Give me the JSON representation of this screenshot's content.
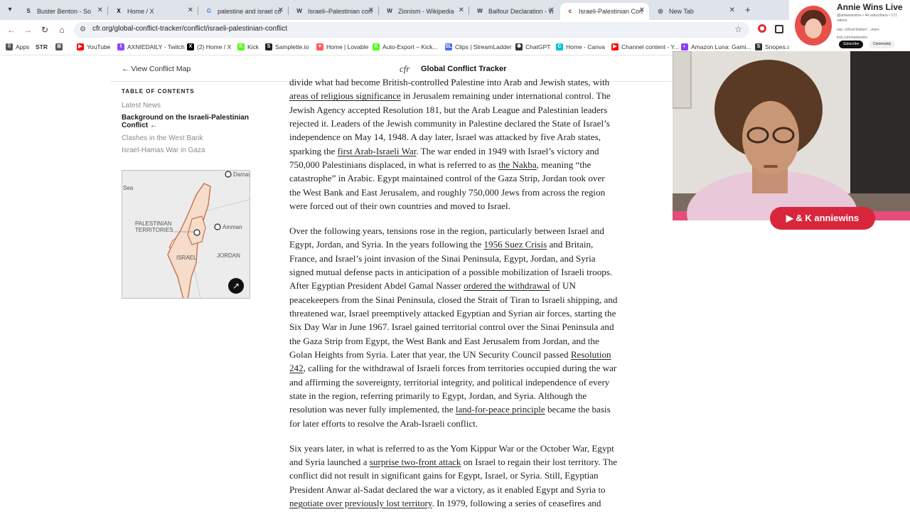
{
  "browser": {
    "tabs": [
      {
        "label": "Buster Benton - So",
        "icon": "soundcloud-icon",
        "color": "#333333",
        "glyph": "S"
      },
      {
        "label": "Home / X",
        "icon": "x-icon",
        "color": "#000000",
        "glyph": "X"
      },
      {
        "label": "palestine and israel co",
        "icon": "google-icon",
        "color": "#4285f4",
        "glyph": "G"
      },
      {
        "label": "Israeli–Palestinian conf",
        "icon": "wikipedia-icon",
        "color": "#333333",
        "glyph": "W"
      },
      {
        "label": "Zionism - Wikipedia",
        "icon": "wikipedia-icon",
        "color": "#333333",
        "glyph": "W"
      },
      {
        "label": "Balfour Declaration - W",
        "icon": "wikipedia-icon",
        "color": "#333333",
        "glyph": "W"
      },
      {
        "label": "Israeli-Palestinian Con",
        "icon": "cfr-icon",
        "color": "#8b1a1a",
        "glyph": "c"
      },
      {
        "label": "New Tab",
        "icon": "chrome-icon",
        "color": "#444444",
        "glyph": "◎"
      }
    ],
    "url": "cfr.org/global-conflict-tracker/conflict/israeli-palestinian-conflict",
    "bookmarks": [
      {
        "label": "Apps",
        "icon": "apps-grid-icon",
        "color": "#555555",
        "glyph": "⠿"
      },
      {
        "label": "STR",
        "icon": "str-icon",
        "color": "#ffffff",
        "glyph": ""
      },
      {
        "label": "",
        "icon": "grid-icon",
        "color": "#555555",
        "glyph": "⊞"
      },
      {
        "label": "YouTube",
        "icon": "youtube-icon",
        "color": "#ff0000",
        "glyph": "▶"
      },
      {
        "label": "AXNIEDAILY - Twitch",
        "icon": "twitch-icon",
        "color": "#9146ff",
        "glyph": "t"
      },
      {
        "label": "(2) Home / X",
        "icon": "x-icon",
        "color": "#000000",
        "glyph": "X"
      },
      {
        "label": "Kick",
        "icon": "kick-icon",
        "color": "#53fc18",
        "glyph": "K"
      },
      {
        "label": "Samplette.io",
        "icon": "samplette-icon",
        "color": "#222222",
        "glyph": "S"
      },
      {
        "label": "Home | Lovable",
        "icon": "lovable-icon",
        "color": "#ff5a5f",
        "glyph": "♥"
      },
      {
        "label": "Auto-Export – Kick...",
        "icon": "kick-icon",
        "color": "#53fc18",
        "glyph": "K"
      },
      {
        "label": "Clips | StreamLadder",
        "icon": "streamladder-icon",
        "color": "#4f6bed",
        "glyph": "SL"
      },
      {
        "label": "ChatGPT",
        "icon": "chatgpt-icon",
        "color": "#333333",
        "glyph": "✺"
      },
      {
        "label": "Home - Canva",
        "icon": "canva-icon",
        "color": "#00c4cc",
        "glyph": "C"
      },
      {
        "label": "Channel content - Y...",
        "icon": "youtube-studio-icon",
        "color": "#ff0000",
        "glyph": "▶"
      },
      {
        "label": "Amazon Luna: Gami...",
        "icon": "luna-icon",
        "color": "#8a3ffc",
        "glyph": "◐"
      },
      {
        "label": "Snopes.com | T...",
        "icon": "snopes-icon",
        "color": "#333333",
        "glyph": "S"
      }
    ]
  },
  "header": {
    "back_link": "← View Conflict Map",
    "logo": "cfr",
    "site_title": "Global Conflict Tracker"
  },
  "toc": {
    "heading": "TABLE OF CONTENTS",
    "items": [
      {
        "label": "Latest News"
      },
      {
        "label": "Background on the Israeli-Palestinian Conflict ←",
        "active": true
      },
      {
        "label": "Clashes in the West Bank"
      },
      {
        "label": "Israel-Hamas War in Gaza"
      }
    ]
  },
  "map": {
    "labels": {
      "sea": "Sea",
      "damascus": "Damas",
      "territories": "PALESTINIAN\nTERRITORIES",
      "amman": "Amman",
      "israel": "ISRAEL",
      "jordan": "JORDAN"
    },
    "colors": {
      "land": "#f5dccb",
      "border": "#c4734a",
      "water": "#ececec"
    }
  },
  "article": {
    "paragraphs": [
      {
        "segments": [
          {
            "t": "divide what had become British-controlled Palestine into Arab and Jewish states, with "
          },
          {
            "t": "areas of religious significance",
            "link": true
          },
          {
            "t": " in Jerusalem remaining under international control. The Jewish Agency accepted Resolution 181, but the Arab League and Palestinian leaders rejected it. Leaders of the Jewish community in Palestine declared the State of Israel’s independence on May 14, 1948. A day later, Israel was attacked by five Arab states, sparking the "
          },
          {
            "t": "first Arab-Israeli War",
            "link": true
          },
          {
            "t": ". The war ended in 1949 with Israel’s victory and 750,000 Palestinians displaced, in what is referred to as "
          },
          {
            "t": "the Nakba",
            "link": true
          },
          {
            "t": ", meaning “the catastrophe” in Arabic. Egypt maintained control of the Gaza Strip, Jordan took over the West Bank and East Jerusalem, and roughly 750,000 Jews from across the region were forced out of their own countries and moved to Israel."
          }
        ]
      },
      {
        "segments": [
          {
            "t": "Over the following years, tensions rose in the region, particularly between Israel and Egypt, Jordan, and Syria. In the years following the "
          },
          {
            "t": "1956 Suez Crisis",
            "link": true
          },
          {
            "t": " and Britain, France, and Israel’s joint invasion of the Sinai Peninsula, Egypt, Jordan, and Syria signed mutual defense pacts in anticipation of a possible mobilization of Israeli troops. After Egyptian President Abdel Gamal Nasser "
          },
          {
            "t": "ordered the withdrawal",
            "link": true
          },
          {
            "t": " of UN peacekeepers from the Sinai Peninsula, closed the Strait of Tiran to Israeli shipping, and threatened war, Israel preemptively attacked Egyptian and Syrian air forces, starting the Six Day War in June 1967. Israel gained territorial control over the Sinai Peninsula and the Gaza Strip from Egypt, the West Bank and East Jerusalem from Jordan, and the Golan Heights from Syria. Later that year, the UN Security Council passed "
          },
          {
            "t": "Resolution 242",
            "link": true
          },
          {
            "t": ", calling for the withdrawal of Israeli forces from territories occupied during the war and affirming the sovereignty, territorial integrity, and political independence of every state in the region, referring primarily to Egypt, Jordan, and Syria. Although the resolution was never fully implemented, the "
          },
          {
            "t": "land-for-peace principle",
            "link": true
          },
          {
            "t": " became the basis for later efforts to resolve the Arab-Israeli conflict."
          }
        ]
      },
      {
        "segments": [
          {
            "t": "Six years later, in what is referred to as the Yom Kippur War or the October War, Egypt and Syria launched a "
          },
          {
            "t": "surprise two-front attack",
            "link": true
          },
          {
            "t": " on Israel to regain their lost territory. The conflict did not result in significant gains for Egypt, Israel, or Syria. Still, Egyptian President Anwar al-Sadat declared the war a victory, as it enabled Egypt and Syria to "
          },
          {
            "t": "negotiate over previously lost territory",
            "link": true
          },
          {
            "t": ". In 1979, following a series of ceasefires and"
          }
        ]
      }
    ]
  },
  "stream": {
    "channel_name": "Annie Wins Live",
    "channel_sub": "@anniewinslive • 44 subscribers • 171 videos",
    "channel_desc": "esp. critical thinker! ...more",
    "channel_link": "kick.com/anniewins",
    "subscribe_label": "Subscribe",
    "community_label": "Community",
    "badge_label": "▶ & K anniewins",
    "colors": {
      "badge": "#d8263c",
      "wall": "#e2ded9",
      "hoodie": "#e9c9d9"
    }
  }
}
